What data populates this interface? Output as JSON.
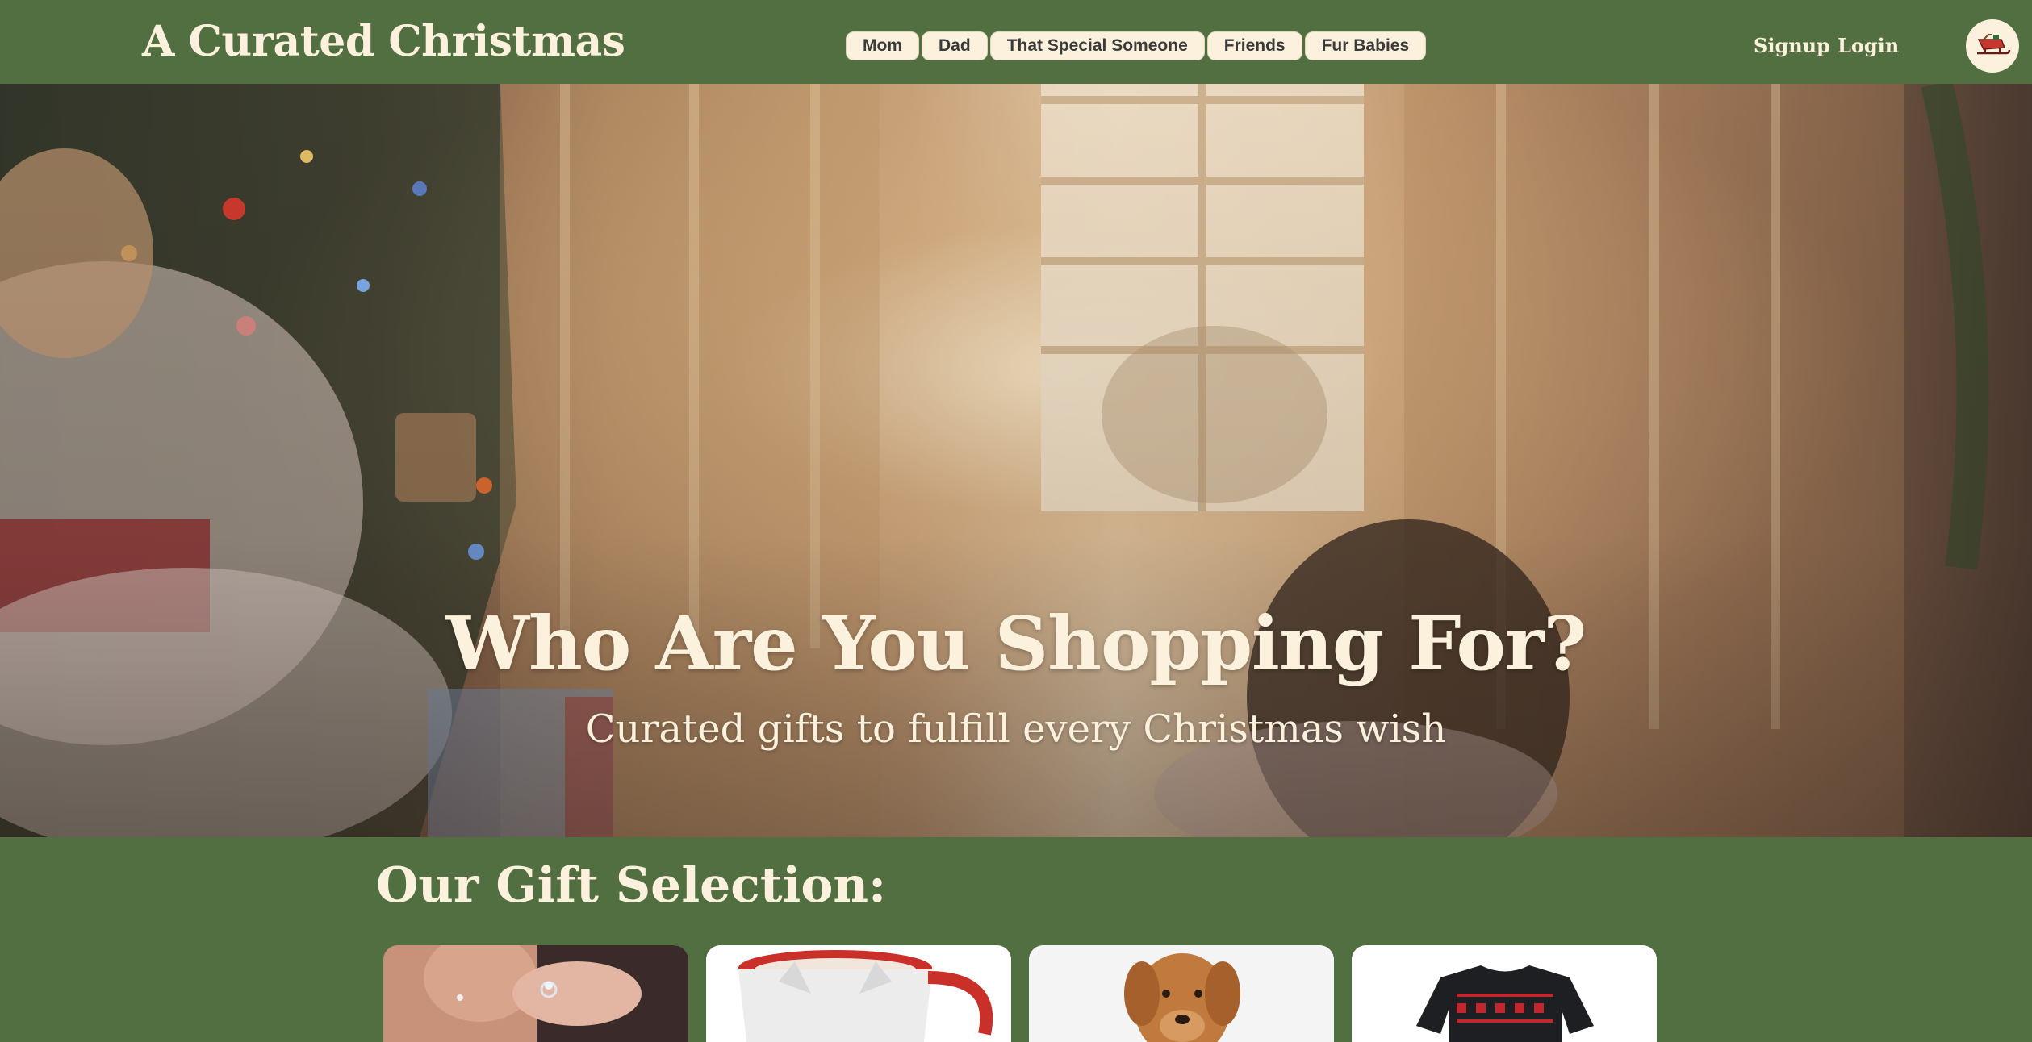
{
  "header": {
    "brand": "A Curated Christmas",
    "nav": [
      {
        "label": "Mom"
      },
      {
        "label": "Dad"
      },
      {
        "label": "That Special Someone"
      },
      {
        "label": "Friends"
      },
      {
        "label": "Fur Babies"
      }
    ],
    "signup_label": "Signup",
    "login_label": "Login",
    "avatar_icon": "sleigh-icon"
  },
  "hero": {
    "title": "Who Are You Shopping For?",
    "subtitle": "Curated gifts to fulfill every Christmas wish"
  },
  "gifts": {
    "title": "Our Gift Selection:",
    "cards": [
      {
        "icon": "ring-photo"
      },
      {
        "icon": "mug-photo"
      },
      {
        "icon": "dog-photo"
      },
      {
        "icon": "sweater-photo"
      }
    ]
  },
  "colors": {
    "brand_green": "#516f40",
    "cream": "#fbf1dc"
  }
}
